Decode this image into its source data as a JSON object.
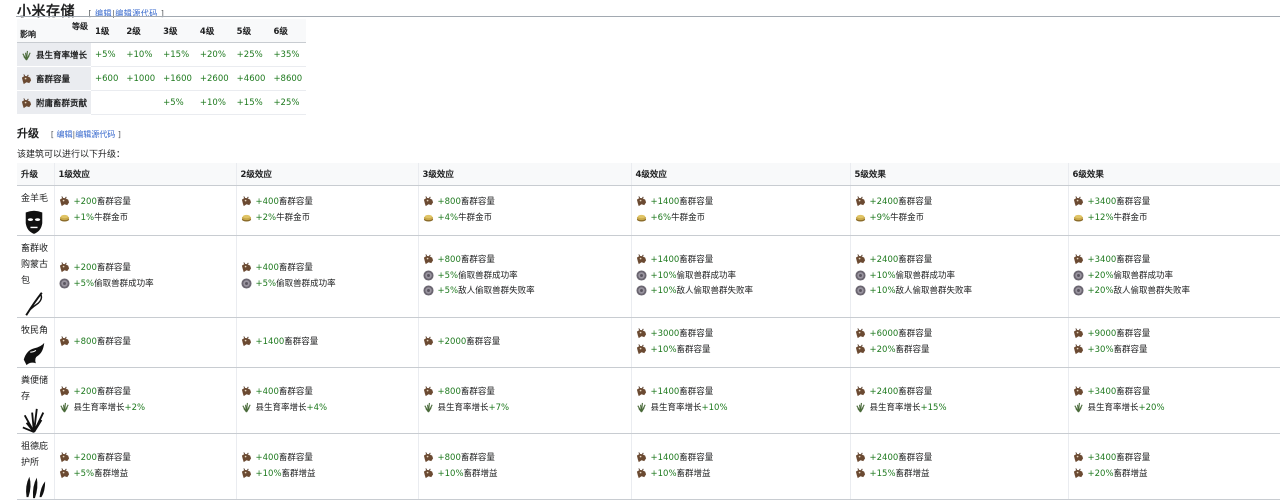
{
  "section1": {
    "title": "小米存储",
    "edit": {
      "open": "[",
      "link": "编辑",
      "sep": "|",
      "link2": "编辑源代码",
      "close": "]"
    },
    "table": {
      "corner_top": "等级",
      "corner_bottom": "影响",
      "levels": [
        "1级",
        "2级",
        "3级",
        "4级",
        "5级",
        "6级"
      ],
      "rows": [
        {
          "label": "县生育率增长",
          "icon": "grass-icon",
          "values": [
            "+5%",
            "+10%",
            "+15%",
            "+20%",
            "+25%",
            "+35%"
          ]
        },
        {
          "label": "畜群容量",
          "icon": "cattle-icon",
          "values": [
            "+600",
            "+1000",
            "+1600",
            "+2600",
            "+4600",
            "+8600"
          ]
        },
        {
          "label": "附庸畜群贡献",
          "icon": "cattle-icon",
          "values": [
            "",
            "",
            "+5%",
            "+10%",
            "+15%",
            "+25%"
          ]
        }
      ]
    }
  },
  "section2": {
    "title": "升级",
    "edit": {
      "open": "[",
      "link": "编辑",
      "sep": "|",
      "link2": "编辑源代码",
      "close": "]"
    },
    "intro": "该建筑可以进行以下升级：",
    "headers": [
      "升级",
      "1级效应",
      "2级效应",
      "3级效应",
      "4级效应",
      "5级效果",
      "6级效果"
    ],
    "rows": [
      {
        "name": [
          "金羊毛"
        ],
        "image": "mask-icon",
        "cells": [
          [
            {
              "icon": "cattle-icon",
              "pre": "",
              "val": "+200",
              "post": "畜群容量"
            },
            {
              "icon": "coins-icon",
              "pre": "",
              "val": "+1%",
              "post": "牛群金币"
            }
          ],
          [
            {
              "icon": "cattle-icon",
              "pre": "",
              "val": "+400",
              "post": "畜群容量"
            },
            {
              "icon": "coins-icon",
              "pre": "",
              "val": "+2%",
              "post": "牛群金币"
            }
          ],
          [
            {
              "icon": "cattle-icon",
              "pre": "",
              "val": "+800",
              "post": "畜群容量"
            },
            {
              "icon": "coins-icon",
              "pre": "",
              "val": "+4%",
              "post": "牛群金币"
            }
          ],
          [
            {
              "icon": "cattle-icon",
              "pre": "",
              "val": "+1400",
              "post": "畜群容量"
            },
            {
              "icon": "coins-icon",
              "pre": "",
              "val": "+6%",
              "post": "牛群金币"
            }
          ],
          [
            {
              "icon": "cattle-icon",
              "pre": "",
              "val": "+2400",
              "post": "畜群容量"
            },
            {
              "icon": "coins-icon",
              "pre": "",
              "val": "+9%",
              "post": "牛群金币"
            }
          ],
          [
            {
              "icon": "cattle-icon",
              "pre": "",
              "val": "+3400",
              "post": "畜群容量"
            },
            {
              "icon": "coins-icon",
              "pre": "",
              "val": "+12%",
              "post": "牛群金币"
            }
          ]
        ]
      },
      {
        "name": [
          "畜群收",
          "购蒙古",
          "包"
        ],
        "image": "lasso-icon",
        "cells": [
          [
            {
              "icon": "cattle-icon",
              "pre": "",
              "val": "+200",
              "post": "畜群容量"
            },
            {
              "icon": "disc-icon",
              "pre": "",
              "val": "+5%",
              "post": "偷取兽群成功率"
            }
          ],
          [
            {
              "icon": "cattle-icon",
              "pre": "",
              "val": "+400",
              "post": "畜群容量"
            },
            {
              "icon": "disc-icon",
              "pre": "",
              "val": "+5%",
              "post": "偷取兽群成功率"
            }
          ],
          [
            {
              "icon": "cattle-icon",
              "pre": "",
              "val": "+800",
              "post": "畜群容量"
            },
            {
              "icon": "disc-icon",
              "pre": "",
              "val": "+5%",
              "post": "偷取兽群成功率"
            },
            {
              "icon": "disc-icon",
              "pre": "",
              "val": "+5%",
              "post": "敌人偷取兽群失败率"
            }
          ],
          [
            {
              "icon": "cattle-icon",
              "pre": "",
              "val": "+1400",
              "post": "畜群容量"
            },
            {
              "icon": "disc-icon",
              "pre": "",
              "val": "+10%",
              "post": "偷取兽群成功率"
            },
            {
              "icon": "disc-icon",
              "pre": "",
              "val": "+10%",
              "post": "敌人偷取兽群失败率"
            }
          ],
          [
            {
              "icon": "cattle-icon",
              "pre": "",
              "val": "+2400",
              "post": "畜群容量"
            },
            {
              "icon": "disc-icon",
              "pre": "",
              "val": "+10%",
              "post": "偷取兽群成功率"
            },
            {
              "icon": "disc-icon",
              "pre": "",
              "val": "+10%",
              "post": "敌人偷取兽群失败率"
            }
          ],
          [
            {
              "icon": "cattle-icon",
              "pre": "",
              "val": "+3400",
              "post": "畜群容量"
            },
            {
              "icon": "disc-icon",
              "pre": "",
              "val": "+20%",
              "post": "偷取兽群成功率"
            },
            {
              "icon": "disc-icon",
              "pre": "",
              "val": "+20%",
              "post": "敌人偷取兽群失败率"
            }
          ]
        ]
      },
      {
        "name": [
          "牧民角"
        ],
        "image": "horn-icon",
        "cells": [
          [
            {
              "icon": "cattle-icon",
              "pre": "",
              "val": "+800",
              "post": "畜群容量"
            }
          ],
          [
            {
              "icon": "cattle-icon",
              "pre": "",
              "val": "+1400",
              "post": "畜群容量"
            }
          ],
          [
            {
              "icon": "cattle-icon",
              "pre": "",
              "val": "+2000",
              "post": "畜群容量"
            }
          ],
          [
            {
              "icon": "cattle-icon",
              "pre": "",
              "val": "+3000",
              "post": "畜群容量"
            },
            {
              "icon": "cattle-icon",
              "pre": "",
              "val": "+10%",
              "post": "畜群容量"
            }
          ],
          [
            {
              "icon": "cattle-icon",
              "pre": "",
              "val": "+6000",
              "post": "畜群容量"
            },
            {
              "icon": "cattle-icon",
              "pre": "",
              "val": "+20%",
              "post": "畜群容量"
            }
          ],
          [
            {
              "icon": "cattle-icon",
              "pre": "",
              "val": "+9000",
              "post": "畜群容量"
            },
            {
              "icon": "cattle-icon",
              "pre": "",
              "val": "+30%",
              "post": "畜群容量"
            }
          ]
        ]
      },
      {
        "name": [
          "粪便储",
          "存"
        ],
        "image": "grass-icon",
        "cells": [
          [
            {
              "icon": "cattle-icon",
              "pre": "",
              "val": "+200",
              "post": "畜群容量"
            },
            {
              "icon": "grass-icon",
              "pre": "县生育率增长",
              "val": "+2%",
              "post": ""
            }
          ],
          [
            {
              "icon": "cattle-icon",
              "pre": "",
              "val": "+400",
              "post": "畜群容量"
            },
            {
              "icon": "grass-icon",
              "pre": "县生育率增长",
              "val": "+4%",
              "post": ""
            }
          ],
          [
            {
              "icon": "cattle-icon",
              "pre": "",
              "val": "+800",
              "post": "畜群容量"
            },
            {
              "icon": "grass-icon",
              "pre": "县生育率增长",
              "val": "+7%",
              "post": ""
            }
          ],
          [
            {
              "icon": "cattle-icon",
              "pre": "",
              "val": "+1400",
              "post": "畜群容量"
            },
            {
              "icon": "grass-icon",
              "pre": "县生育率增长",
              "val": "+10%",
              "post": ""
            }
          ],
          [
            {
              "icon": "cattle-icon",
              "pre": "",
              "val": "+2400",
              "post": "畜群容量"
            },
            {
              "icon": "grass-icon",
              "pre": "县生育率增长",
              "val": "+15%",
              "post": ""
            }
          ],
          [
            {
              "icon": "cattle-icon",
              "pre": "",
              "val": "+3400",
              "post": "畜群容量"
            },
            {
              "icon": "grass-icon",
              "pre": "县生育率增长",
              "val": "+20%",
              "post": ""
            }
          ]
        ]
      },
      {
        "name": [
          "祖德庇",
          "护所"
        ],
        "image": "feathers-icon",
        "cells": [
          [
            {
              "icon": "cattle-icon",
              "pre": "",
              "val": "+200",
              "post": "畜群容量"
            },
            {
              "icon": "cattle-icon",
              "pre": "",
              "val": "+5%",
              "post": "畜群增益"
            }
          ],
          [
            {
              "icon": "cattle-icon",
              "pre": "",
              "val": "+400",
              "post": "畜群容量"
            },
            {
              "icon": "cattle-icon",
              "pre": "",
              "val": "+10%",
              "post": "畜群增益"
            }
          ],
          [
            {
              "icon": "cattle-icon",
              "pre": "",
              "val": "+800",
              "post": "畜群容量"
            },
            {
              "icon": "cattle-icon",
              "pre": "",
              "val": "+10%",
              "post": "畜群增益"
            }
          ],
          [
            {
              "icon": "cattle-icon",
              "pre": "",
              "val": "+1400",
              "post": "畜群容量"
            },
            {
              "icon": "cattle-icon",
              "pre": "",
              "val": "+10%",
              "post": "畜群增益"
            }
          ],
          [
            {
              "icon": "cattle-icon",
              "pre": "",
              "val": "+2400",
              "post": "畜群容量"
            },
            {
              "icon": "cattle-icon",
              "pre": "",
              "val": "+15%",
              "post": "畜群增益"
            }
          ],
          [
            {
              "icon": "cattle-icon",
              "pre": "",
              "val": "+3400",
              "post": "畜群容量"
            },
            {
              "icon": "cattle-icon",
              "pre": "",
              "val": "+20%",
              "post": "畜群增益"
            }
          ]
        ]
      }
    ]
  },
  "colors": {
    "positive": "#1f7a1f",
    "link": "#3366cc",
    "header_bg": "#f8f9fa",
    "row_header_bg": "#eaecf0"
  }
}
